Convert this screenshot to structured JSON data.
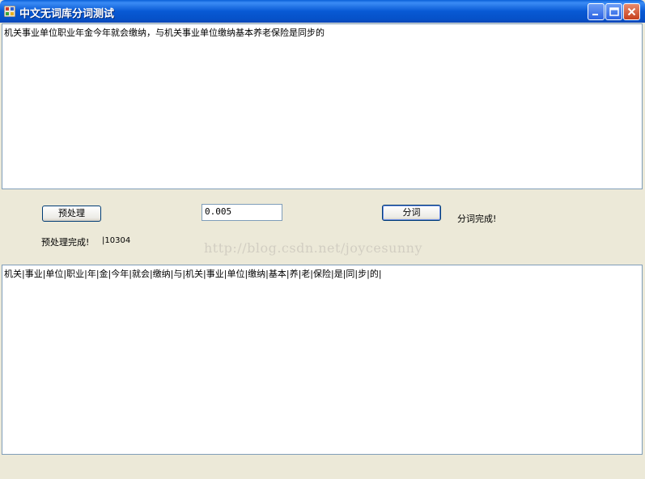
{
  "window": {
    "title": "中文无词库分词测试",
    "controls": {
      "minimize": "minimize-icon",
      "maximize": "maximize-icon",
      "close": "close-icon"
    }
  },
  "input": {
    "text": "机关事业单位职业年金今年就会缴纳，与机关事业单位缴纳基本养老保险是同步的"
  },
  "controls": {
    "preprocess_button": "预处理",
    "threshold_value": "0.005",
    "segment_button": "分词",
    "segment_status": "分词完成!",
    "preprocess_status": "预处理完成!",
    "count": "|10304"
  },
  "output": {
    "text": "机关|事业|单位|职业|年|金|今年|就会|缴纳|与|机关|事业|单位|缴纳|基本|养|老|保险|是|同|步|的|"
  },
  "watermark": "http://blog.csdn.net/joycesunny",
  "colors": {
    "titlebar": "#0A5FD8",
    "background": "#ECE9D8",
    "border": "#7F9DB9"
  }
}
